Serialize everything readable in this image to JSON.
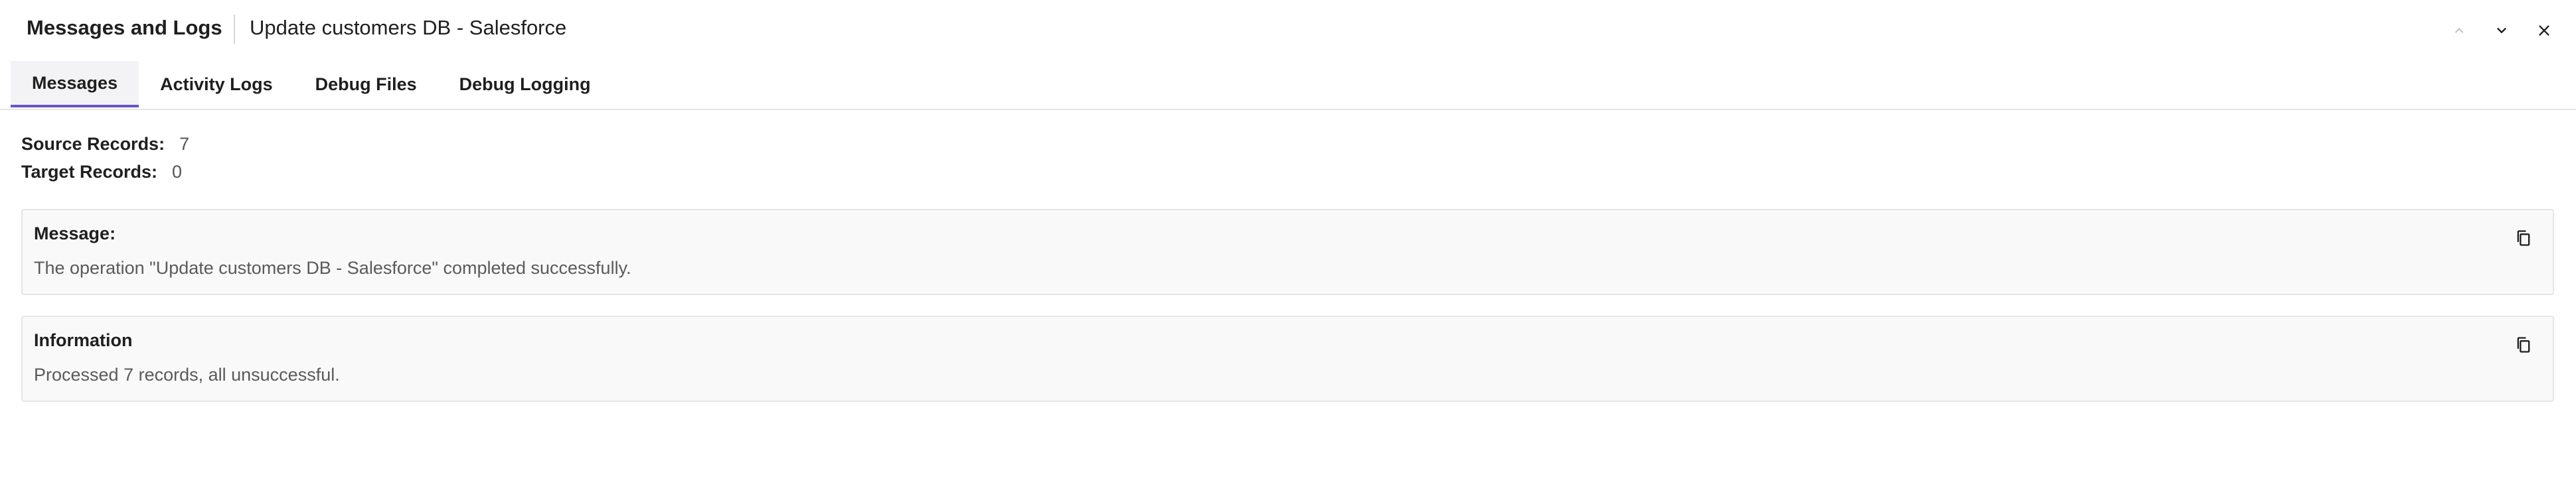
{
  "header": {
    "title": "Messages and Logs",
    "subtitle": "Update customers DB - Salesforce",
    "actions": [
      {
        "name": "chevron-up-icon",
        "label": "Previous"
      },
      {
        "name": "chevron-down-icon",
        "label": "Next"
      },
      {
        "name": "close-icon",
        "label": "Close"
      }
    ]
  },
  "tabs": [
    {
      "label": "Messages",
      "active": true
    },
    {
      "label": "Activity Logs",
      "active": false
    },
    {
      "label": "Debug Files",
      "active": false
    },
    {
      "label": "Debug Logging",
      "active": false
    }
  ],
  "summary": {
    "source_label": "Source Records:",
    "source_value": "7",
    "target_label": "Target Records:",
    "target_value": "0"
  },
  "messages": [
    {
      "title": "Message:",
      "text": "The operation \"Update customers DB - Salesforce\" completed successfully.",
      "icon": "copy-icon"
    },
    {
      "title": "Information",
      "text": "Processed 7 records, all unsuccessful.",
      "icon": "copy-icon"
    }
  ],
  "colors": {
    "accent": "#6a55c8",
    "card_background": "#f9f9f9",
    "card_border": "#e6e6e6",
    "muted_text": "#5a5a5a"
  }
}
